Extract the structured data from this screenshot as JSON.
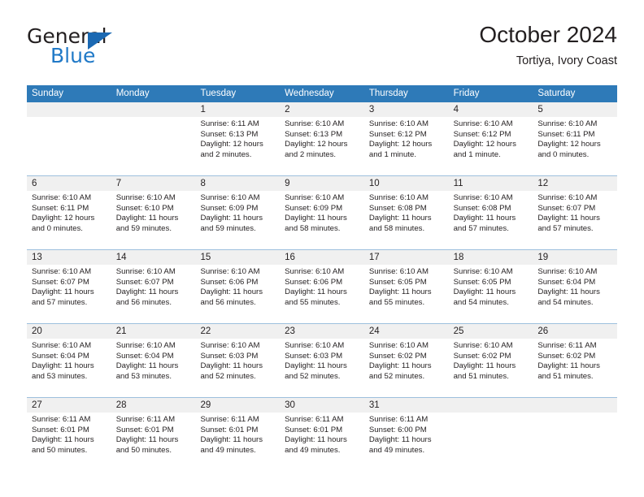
{
  "brand": {
    "name_part1": "General",
    "name_part2": "Blue",
    "triangle_color": "#1b69b3",
    "blue_color": "#2079c7"
  },
  "header": {
    "title": "October 2024",
    "subtitle": "Tortiya, Ivory Coast"
  },
  "theme": {
    "header_bg": "#2e7ab8",
    "daynum_bg": "#f0f0f0",
    "row_divider": "#9dc0dd",
    "text": "#231f20"
  },
  "weekdays": [
    "Sunday",
    "Monday",
    "Tuesday",
    "Wednesday",
    "Thursday",
    "Friday",
    "Saturday"
  ],
  "weeks": [
    [
      {
        "day": "",
        "sunrise": "",
        "sunset": "",
        "daylight_line1": "",
        "daylight_line2": ""
      },
      {
        "day": "",
        "sunrise": "",
        "sunset": "",
        "daylight_line1": "",
        "daylight_line2": ""
      },
      {
        "day": "1",
        "sunrise": "Sunrise: 6:11 AM",
        "sunset": "Sunset: 6:13 PM",
        "daylight_line1": "Daylight: 12 hours",
        "daylight_line2": "and 2 minutes."
      },
      {
        "day": "2",
        "sunrise": "Sunrise: 6:10 AM",
        "sunset": "Sunset: 6:13 PM",
        "daylight_line1": "Daylight: 12 hours",
        "daylight_line2": "and 2 minutes."
      },
      {
        "day": "3",
        "sunrise": "Sunrise: 6:10 AM",
        "sunset": "Sunset: 6:12 PM",
        "daylight_line1": "Daylight: 12 hours",
        "daylight_line2": "and 1 minute."
      },
      {
        "day": "4",
        "sunrise": "Sunrise: 6:10 AM",
        "sunset": "Sunset: 6:12 PM",
        "daylight_line1": "Daylight: 12 hours",
        "daylight_line2": "and 1 minute."
      },
      {
        "day": "5",
        "sunrise": "Sunrise: 6:10 AM",
        "sunset": "Sunset: 6:11 PM",
        "daylight_line1": "Daylight: 12 hours",
        "daylight_line2": "and 0 minutes."
      }
    ],
    [
      {
        "day": "6",
        "sunrise": "Sunrise: 6:10 AM",
        "sunset": "Sunset: 6:11 PM",
        "daylight_line1": "Daylight: 12 hours",
        "daylight_line2": "and 0 minutes."
      },
      {
        "day": "7",
        "sunrise": "Sunrise: 6:10 AM",
        "sunset": "Sunset: 6:10 PM",
        "daylight_line1": "Daylight: 11 hours",
        "daylight_line2": "and 59 minutes."
      },
      {
        "day": "8",
        "sunrise": "Sunrise: 6:10 AM",
        "sunset": "Sunset: 6:09 PM",
        "daylight_line1": "Daylight: 11 hours",
        "daylight_line2": "and 59 minutes."
      },
      {
        "day": "9",
        "sunrise": "Sunrise: 6:10 AM",
        "sunset": "Sunset: 6:09 PM",
        "daylight_line1": "Daylight: 11 hours",
        "daylight_line2": "and 58 minutes."
      },
      {
        "day": "10",
        "sunrise": "Sunrise: 6:10 AM",
        "sunset": "Sunset: 6:08 PM",
        "daylight_line1": "Daylight: 11 hours",
        "daylight_line2": "and 58 minutes."
      },
      {
        "day": "11",
        "sunrise": "Sunrise: 6:10 AM",
        "sunset": "Sunset: 6:08 PM",
        "daylight_line1": "Daylight: 11 hours",
        "daylight_line2": "and 57 minutes."
      },
      {
        "day": "12",
        "sunrise": "Sunrise: 6:10 AM",
        "sunset": "Sunset: 6:07 PM",
        "daylight_line1": "Daylight: 11 hours",
        "daylight_line2": "and 57 minutes."
      }
    ],
    [
      {
        "day": "13",
        "sunrise": "Sunrise: 6:10 AM",
        "sunset": "Sunset: 6:07 PM",
        "daylight_line1": "Daylight: 11 hours",
        "daylight_line2": "and 57 minutes."
      },
      {
        "day": "14",
        "sunrise": "Sunrise: 6:10 AM",
        "sunset": "Sunset: 6:07 PM",
        "daylight_line1": "Daylight: 11 hours",
        "daylight_line2": "and 56 minutes."
      },
      {
        "day": "15",
        "sunrise": "Sunrise: 6:10 AM",
        "sunset": "Sunset: 6:06 PM",
        "daylight_line1": "Daylight: 11 hours",
        "daylight_line2": "and 56 minutes."
      },
      {
        "day": "16",
        "sunrise": "Sunrise: 6:10 AM",
        "sunset": "Sunset: 6:06 PM",
        "daylight_line1": "Daylight: 11 hours",
        "daylight_line2": "and 55 minutes."
      },
      {
        "day": "17",
        "sunrise": "Sunrise: 6:10 AM",
        "sunset": "Sunset: 6:05 PM",
        "daylight_line1": "Daylight: 11 hours",
        "daylight_line2": "and 55 minutes."
      },
      {
        "day": "18",
        "sunrise": "Sunrise: 6:10 AM",
        "sunset": "Sunset: 6:05 PM",
        "daylight_line1": "Daylight: 11 hours",
        "daylight_line2": "and 54 minutes."
      },
      {
        "day": "19",
        "sunrise": "Sunrise: 6:10 AM",
        "sunset": "Sunset: 6:04 PM",
        "daylight_line1": "Daylight: 11 hours",
        "daylight_line2": "and 54 minutes."
      }
    ],
    [
      {
        "day": "20",
        "sunrise": "Sunrise: 6:10 AM",
        "sunset": "Sunset: 6:04 PM",
        "daylight_line1": "Daylight: 11 hours",
        "daylight_line2": "and 53 minutes."
      },
      {
        "day": "21",
        "sunrise": "Sunrise: 6:10 AM",
        "sunset": "Sunset: 6:04 PM",
        "daylight_line1": "Daylight: 11 hours",
        "daylight_line2": "and 53 minutes."
      },
      {
        "day": "22",
        "sunrise": "Sunrise: 6:10 AM",
        "sunset": "Sunset: 6:03 PM",
        "daylight_line1": "Daylight: 11 hours",
        "daylight_line2": "and 52 minutes."
      },
      {
        "day": "23",
        "sunrise": "Sunrise: 6:10 AM",
        "sunset": "Sunset: 6:03 PM",
        "daylight_line1": "Daylight: 11 hours",
        "daylight_line2": "and 52 minutes."
      },
      {
        "day": "24",
        "sunrise": "Sunrise: 6:10 AM",
        "sunset": "Sunset: 6:02 PM",
        "daylight_line1": "Daylight: 11 hours",
        "daylight_line2": "and 52 minutes."
      },
      {
        "day": "25",
        "sunrise": "Sunrise: 6:10 AM",
        "sunset": "Sunset: 6:02 PM",
        "daylight_line1": "Daylight: 11 hours",
        "daylight_line2": "and 51 minutes."
      },
      {
        "day": "26",
        "sunrise": "Sunrise: 6:11 AM",
        "sunset": "Sunset: 6:02 PM",
        "daylight_line1": "Daylight: 11 hours",
        "daylight_line2": "and 51 minutes."
      }
    ],
    [
      {
        "day": "27",
        "sunrise": "Sunrise: 6:11 AM",
        "sunset": "Sunset: 6:01 PM",
        "daylight_line1": "Daylight: 11 hours",
        "daylight_line2": "and 50 minutes."
      },
      {
        "day": "28",
        "sunrise": "Sunrise: 6:11 AM",
        "sunset": "Sunset: 6:01 PM",
        "daylight_line1": "Daylight: 11 hours",
        "daylight_line2": "and 50 minutes."
      },
      {
        "day": "29",
        "sunrise": "Sunrise: 6:11 AM",
        "sunset": "Sunset: 6:01 PM",
        "daylight_line1": "Daylight: 11 hours",
        "daylight_line2": "and 49 minutes."
      },
      {
        "day": "30",
        "sunrise": "Sunrise: 6:11 AM",
        "sunset": "Sunset: 6:01 PM",
        "daylight_line1": "Daylight: 11 hours",
        "daylight_line2": "and 49 minutes."
      },
      {
        "day": "31",
        "sunrise": "Sunrise: 6:11 AM",
        "sunset": "Sunset: 6:00 PM",
        "daylight_line1": "Daylight: 11 hours",
        "daylight_line2": "and 49 minutes."
      },
      {
        "day": "",
        "sunrise": "",
        "sunset": "",
        "daylight_line1": "",
        "daylight_line2": ""
      },
      {
        "day": "",
        "sunrise": "",
        "sunset": "",
        "daylight_line1": "",
        "daylight_line2": ""
      }
    ]
  ]
}
